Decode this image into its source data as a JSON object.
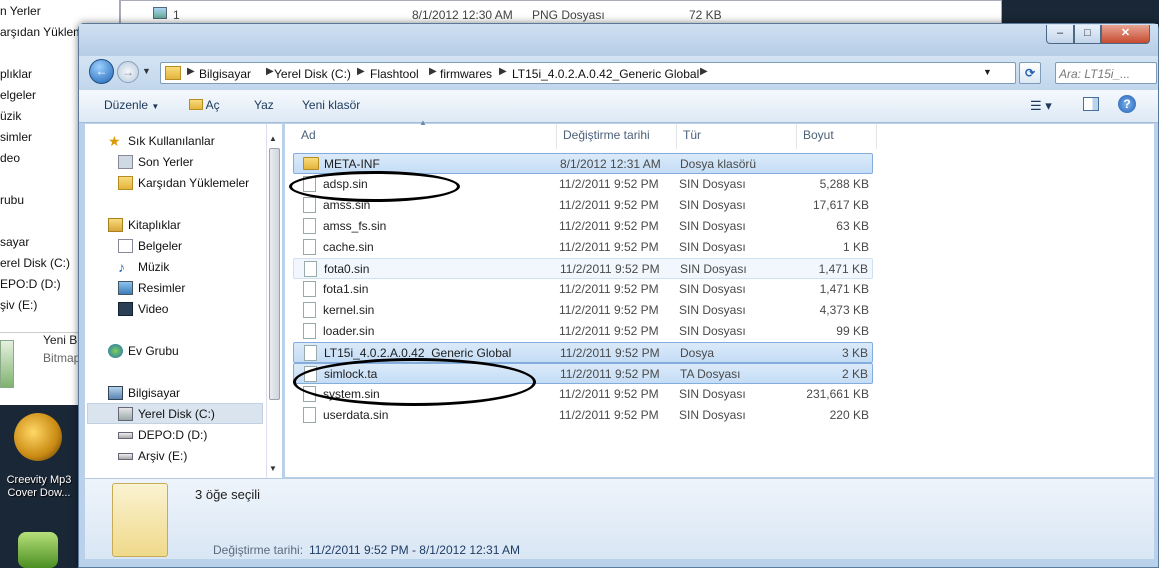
{
  "background_window": {
    "sidebar_items": [
      "n Yerler",
      "arşıdan Yükleme",
      "plıklar",
      "elgeler",
      "üzik",
      "simler",
      "deo",
      "rubu",
      "sayar",
      "erel Disk (C:)",
      "EPO:D (D:)",
      "şiv (E:)"
    ],
    "top_row": {
      "name": "1",
      "date": "8/1/2012 12:30 AM",
      "type": "PNG Dosyası",
      "size": "72 KB"
    },
    "partial_file": {
      "name": "Yeni B",
      "type": "Bitmap"
    }
  },
  "desktop_icons": [
    {
      "label": "Creevity Mp3 Cover Dow..."
    }
  ],
  "window": {
    "caption_buttons": {
      "minimize": "–",
      "maximize": "□",
      "close": "✕"
    },
    "breadcrumbs": [
      "Bilgisayar",
      "Yerel Disk (C:)",
      "Flashtool",
      "firmwares",
      "LT15i_4.0.2.A.0.42_Generic Global"
    ],
    "search_placeholder": "Ara: LT15i_...",
    "toolbar": {
      "organize": "Düzenle",
      "open": "Aç",
      "print": "Yaz",
      "new_folder": "Yeni klasör"
    },
    "nav": {
      "favorites_header": "Sık Kullanılanlar",
      "favorites": [
        "Son Yerler",
        "Karşıdan Yüklemeler"
      ],
      "libraries_header": "Kitaplıklar",
      "libraries": [
        "Belgeler",
        "Müzik",
        "Resimler",
        "Video"
      ],
      "homegroup": "Ev Grubu",
      "computer_header": "Bilgisayar",
      "drives": [
        "Yerel Disk (C:)",
        "DEPO:D (D:)",
        "Arşiv (E:)"
      ]
    },
    "columns": {
      "name": "Ad",
      "date": "Değiştirme tarihi",
      "type": "Tür",
      "size": "Boyut"
    },
    "files": [
      {
        "name": "META-INF",
        "date": "8/1/2012 12:31 AM",
        "type": "Dosya klasörü",
        "size": "",
        "selected": true,
        "folder": true
      },
      {
        "name": "adsp.sin",
        "date": "11/2/2011 9:52 PM",
        "type": "SIN Dosyası",
        "size": "5,288 KB",
        "selected": false
      },
      {
        "name": "amss.sin",
        "date": "11/2/2011 9:52 PM",
        "type": "SIN Dosyası",
        "size": "17,617 KB",
        "selected": false
      },
      {
        "name": "amss_fs.sin",
        "date": "11/2/2011 9:52 PM",
        "type": "SIN Dosyası",
        "size": "63 KB",
        "selected": false
      },
      {
        "name": "cache.sin",
        "date": "11/2/2011 9:52 PM",
        "type": "SIN Dosyası",
        "size": "1 KB",
        "selected": false
      },
      {
        "name": "fota0.sin",
        "date": "11/2/2011 9:52 PM",
        "type": "SIN Dosyası",
        "size": "1,471 KB",
        "selected": false,
        "hover": true
      },
      {
        "name": "fota1.sin",
        "date": "11/2/2011 9:52 PM",
        "type": "SIN Dosyası",
        "size": "1,471 KB",
        "selected": false
      },
      {
        "name": "kernel.sin",
        "date": "11/2/2011 9:52 PM",
        "type": "SIN Dosyası",
        "size": "4,373 KB",
        "selected": false
      },
      {
        "name": "loader.sin",
        "date": "11/2/2011 9:52 PM",
        "type": "SIN Dosyası",
        "size": "99 KB",
        "selected": false
      },
      {
        "name": "LT15i_4.0.2.A.0.42_Generic Global",
        "date": "11/2/2011 9:52 PM",
        "type": "Dosya",
        "size": "3 KB",
        "selected": true
      },
      {
        "name": "simlock.ta",
        "date": "11/2/2011 9:52 PM",
        "type": "TA Dosyası",
        "size": "2 KB",
        "selected": true
      },
      {
        "name": "system.sin",
        "date": "11/2/2011 9:52 PM",
        "type": "SIN Dosyası",
        "size": "231,661 KB",
        "selected": false
      },
      {
        "name": "userdata.sin",
        "date": "11/2/2011 9:52 PM",
        "type": "SIN Dosyası",
        "size": "220 KB",
        "selected": false
      }
    ],
    "details": {
      "count": "3 öğe seçili",
      "date_label": "Değiştirme tarihi:",
      "date_value": "11/2/2011 9:52 PM - 8/1/2012 12:31 AM"
    }
  }
}
